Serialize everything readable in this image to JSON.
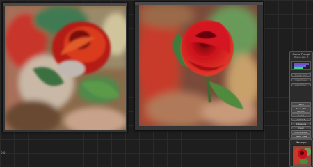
{
  "queue_panel": {
    "title": "Queue Prompt",
    "size_label": "Queue size: 0",
    "queue_front": "Queue Front",
    "see_queue": "View Queue",
    "see_history": "View History",
    "save": "Save",
    "save_api": "Save (API Format)",
    "load": "Load",
    "refresh": "Refresh",
    "clipspace": "Clipspace",
    "clear": "Clear",
    "load_default": "Load Default",
    "reset_view": "Reset View",
    "extra_check": "✓"
  },
  "manager_panel": {
    "title": "Manager"
  },
  "corner": {
    "label": "0 0"
  },
  "images": {
    "left": "blurred painterly rose",
    "right": "red rose photo"
  },
  "colors": {
    "canvas_bg": "#1e1e1e",
    "node_bg": "#353535",
    "rose_red": "#c8101a"
  }
}
